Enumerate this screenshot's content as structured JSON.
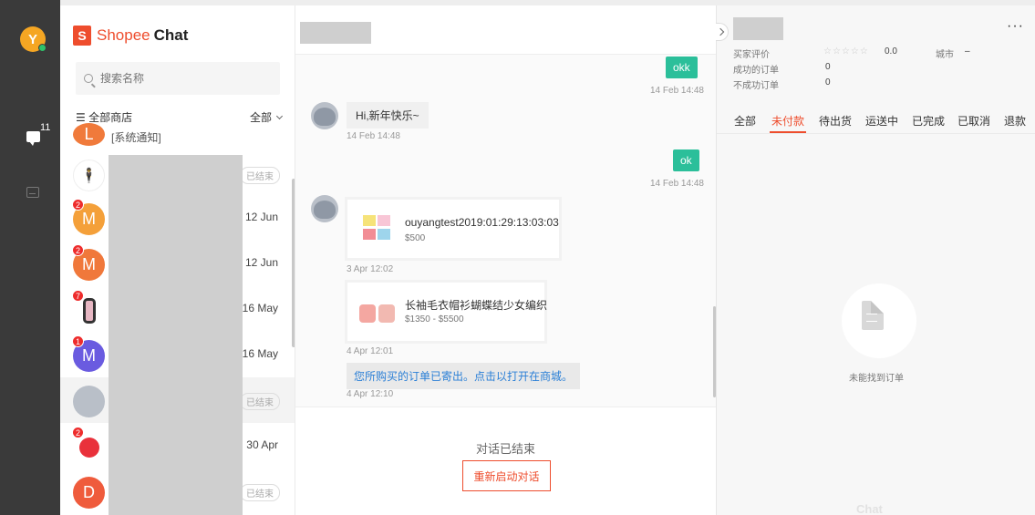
{
  "rail": {
    "avatar_letter": "Y",
    "chat_count": "11"
  },
  "brand": {
    "logo_mark": "S",
    "name_part1": "Shopee",
    "name_part2": "Chat"
  },
  "search": {
    "placeholder": "搜索名称"
  },
  "filter": {
    "store_label": "全部商店",
    "status_label": "全部"
  },
  "conversations": [
    {
      "letter": "L",
      "color": "#f07a3b",
      "preview": "[系统通知]"
    },
    {
      "status": "已结束",
      "avatar": "silhouette"
    },
    {
      "letter": "M",
      "color": "#f08a35",
      "badge": "2",
      "date": "12 Jun"
    },
    {
      "letter": "M",
      "color": "#f0783b",
      "badge": "2",
      "date": "12 Jun"
    },
    {
      "avatar": "watch",
      "badge": "7",
      "date": "16 May"
    },
    {
      "letter": "M",
      "color": "#6a5be0",
      "badge": "1",
      "date": "16 May"
    },
    {
      "status": "已结束",
      "avatar": "user"
    },
    {
      "avatar": "red-circle",
      "badge": "2",
      "date": "30 Apr"
    },
    {
      "letter": "D",
      "color": "#ef5b3c",
      "status": "已结束"
    }
  ],
  "chat": {
    "messages": {
      "m1_text": "okk",
      "m1_time": "14 Feb 14:48",
      "m2_text": "Hi,新年快乐~",
      "m2_time": "14 Feb 14:48",
      "m3_text": "ok",
      "m3_time": "14 Feb 14:48",
      "card1_title": "ouyangtest2019:01:29:13:03:03",
      "card1_price": "$500",
      "card1_time": "3 Apr 12:02",
      "card2_title": "长袖毛衣帽衫蝴蝶结少女编织",
      "card2_price": "$1350 - $5500",
      "card2_time": "4 Apr 12:01",
      "notice_text": "您所购买的订单已寄出。点击以打开在商城。",
      "notice_time": "4 Apr 12:10"
    },
    "ended_text": "对话已结束",
    "restart_label": "重新启动对话"
  },
  "buyer": {
    "more_label": "···",
    "rating_label": "买家评价",
    "stars": "☆☆☆☆☆",
    "rating_value": "0.0",
    "city_label": "城市",
    "city_value": "–",
    "success_label": "成功的订单",
    "success_value": "0",
    "fail_label": "不成功订单",
    "fail_value": "0",
    "tabs": [
      "全部",
      "未付款",
      "待出货",
      "运送中",
      "已完成",
      "已取消",
      "退款"
    ],
    "active_tab": "未付款",
    "empty_text": "未能找到订单",
    "watermark": "Chat"
  },
  "colors": {
    "brand": "#ee4d2d",
    "accent_green": "#2bbf9a",
    "rail": "#3a3a3a"
  }
}
